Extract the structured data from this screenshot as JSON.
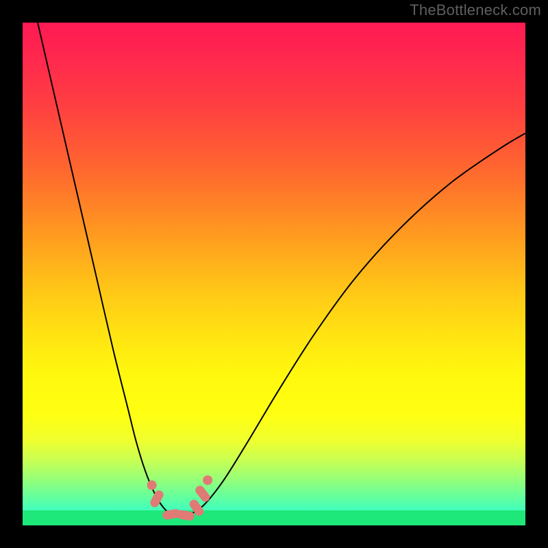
{
  "attribution": "TheBottleneck.com",
  "colors": {
    "background": "#000000",
    "curve": "#000000",
    "marker": "#e07a75",
    "greenSlab": "#1fe87a"
  },
  "chart_data": {
    "type": "line",
    "title": "",
    "xlabel": "",
    "ylabel": "",
    "xlim": [
      0,
      1
    ],
    "ylim": [
      0,
      1
    ],
    "series": [
      {
        "name": "left-curve",
        "x": [
          0.03,
          0.06,
          0.09,
          0.12,
          0.15,
          0.18,
          0.21,
          0.225,
          0.24,
          0.255,
          0.27,
          0.285,
          0.3
        ],
        "y": [
          1.0,
          0.87,
          0.74,
          0.61,
          0.48,
          0.35,
          0.23,
          0.17,
          0.12,
          0.08,
          0.05,
          0.03,
          0.02
        ]
      },
      {
        "name": "right-curve",
        "x": [
          0.33,
          0.36,
          0.4,
          0.45,
          0.51,
          0.58,
          0.66,
          0.75,
          0.85,
          0.95,
          1.0
        ],
        "y": [
          0.02,
          0.04,
          0.09,
          0.17,
          0.27,
          0.38,
          0.49,
          0.59,
          0.68,
          0.75,
          0.78
        ]
      },
      {
        "name": "valley-floor",
        "x": [
          0.3,
          0.315,
          0.33
        ],
        "y": [
          0.02,
          0.018,
          0.02
        ]
      }
    ],
    "markers": [
      {
        "shape": "circle",
        "x": 0.257,
        "y": 0.08
      },
      {
        "shape": "pill",
        "x": 0.267,
        "y": 0.053,
        "angle": -62
      },
      {
        "shape": "pill",
        "x": 0.296,
        "y": 0.022,
        "angle": -10
      },
      {
        "shape": "pill",
        "x": 0.324,
        "y": 0.02,
        "angle": 10
      },
      {
        "shape": "pill",
        "x": 0.346,
        "y": 0.035,
        "angle": 55
      },
      {
        "shape": "pill",
        "x": 0.358,
        "y": 0.063,
        "angle": 52
      },
      {
        "shape": "circle",
        "x": 0.368,
        "y": 0.09
      }
    ]
  }
}
